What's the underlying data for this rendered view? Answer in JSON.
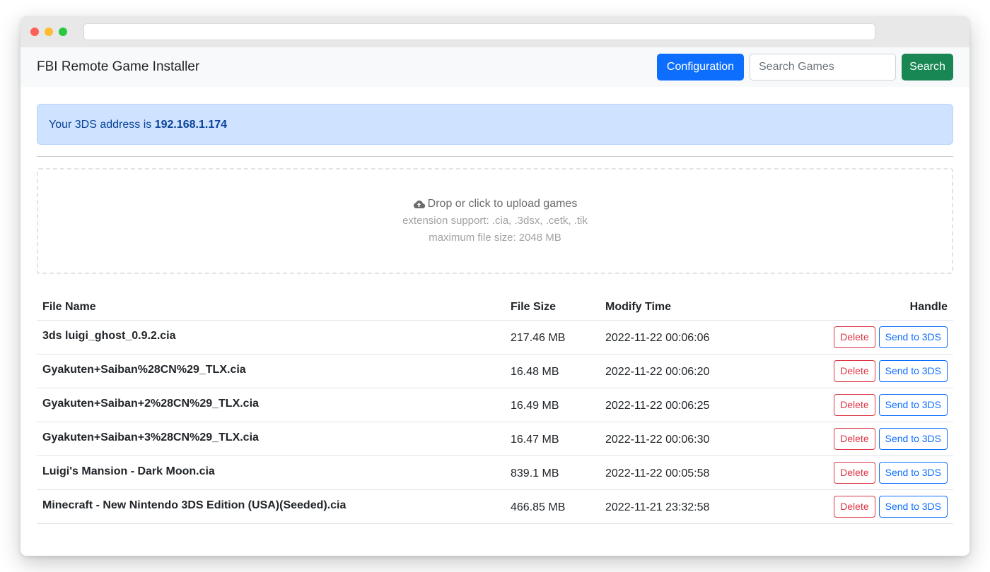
{
  "navbar": {
    "brand": "FBI Remote Game Installer",
    "config_label": "Configuration",
    "search_placeholder": "Search Games",
    "search_label": "Search"
  },
  "alert": {
    "prefix": "Your 3DS address is ",
    "address": "192.168.1.174"
  },
  "dropzone": {
    "title": "Drop or click to upload games",
    "extensions": "extension support: .cia, .3dsx, .cetk, .tik",
    "max_size": "maximum file size: 2048 MB",
    "icon": "cloud-upload-icon"
  },
  "table": {
    "headers": {
      "name": "File Name",
      "size": "File Size",
      "time": "Modify Time",
      "handle": "Handle"
    },
    "delete_label": "Delete",
    "send_label": "Send to 3DS",
    "rows": [
      {
        "name": "3ds luigi_ghost_0.9.2.cia",
        "size": "217.46 MB",
        "time": "2022-11-22 00:06:06"
      },
      {
        "name": "Gyakuten+Saiban%28CN%29_TLX.cia",
        "size": "16.48 MB",
        "time": "2022-11-22 00:06:20"
      },
      {
        "name": "Gyakuten+Saiban+2%28CN%29_TLX.cia",
        "size": "16.49 MB",
        "time": "2022-11-22 00:06:25"
      },
      {
        "name": "Gyakuten+Saiban+3%28CN%29_TLX.cia",
        "size": "16.47 MB",
        "time": "2022-11-22 00:06:30"
      },
      {
        "name": "Luigi's Mansion - Dark Moon.cia",
        "size": "839.1 MB",
        "time": "2022-11-22 00:05:58"
      },
      {
        "name": "Minecraft - New Nintendo 3DS Edition (USA)(Seeded).cia",
        "size": "466.85 MB",
        "time": "2022-11-21 23:32:58"
      }
    ]
  },
  "colors": {
    "primary": "#0d6efd",
    "success": "#198754",
    "danger": "#dc3545",
    "alert_bg": "#cfe2ff",
    "alert_text": "#084298"
  }
}
